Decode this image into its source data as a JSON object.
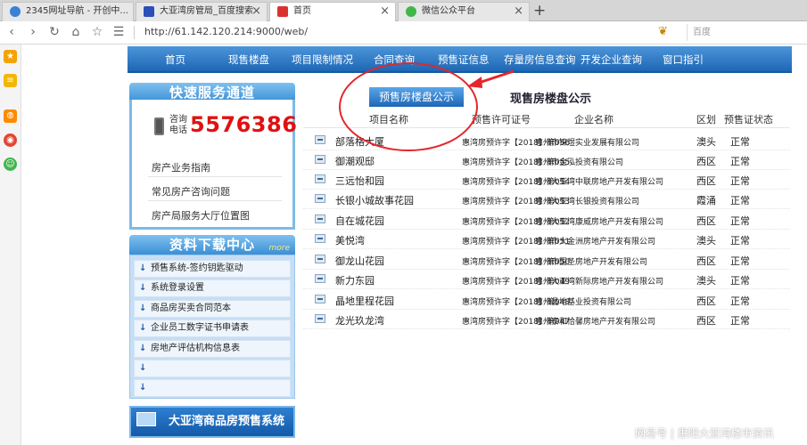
{
  "browser": {
    "tabs": [
      {
        "title": "2345网址导航 - 开创中...",
        "favicon_color": "#3b82d6",
        "active": false
      },
      {
        "title": "大亚湾房管局_百度搜索",
        "favicon_color": "#2b4fb8",
        "active": false
      },
      {
        "title": "首页",
        "favicon_color": "#d9322e",
        "active": true
      },
      {
        "title": "微信公众平台",
        "favicon_color": "#43b649",
        "active": false
      }
    ],
    "new_tab_label": "+",
    "tab_close_label": "×",
    "url": "http://61.142.120.214:9000/web/",
    "search_placeholder": "百度",
    "nav_icons": [
      "back-icon",
      "forward-icon",
      "reload-icon",
      "home-icon",
      "star-icon",
      "reader-icon"
    ]
  },
  "sidebar_icons": [
    {
      "name": "favorites-icon",
      "color": "#f4a300"
    },
    {
      "name": "notes-icon",
      "color": "#f2b705"
    },
    {
      "name": "rss-icon",
      "color": "#ff8a00"
    },
    {
      "name": "weibo-icon",
      "color": "#e24530"
    },
    {
      "name": "game-icon",
      "color": "#42b54f"
    }
  ],
  "site_nav": [
    "首页",
    "现售楼盘",
    "项目限制情况",
    "合同查询",
    "预售证信息",
    "存量房信息查询",
    "开发企业查询",
    "窗口指引"
  ],
  "service": {
    "title": "快速服务通道",
    "phone_label_1": "咨询",
    "phone_label_2": "电话",
    "phone_number": "5576386",
    "links": [
      "房产业务指南",
      "常见房产咨询问题",
      "房产局服务大厅位置图"
    ]
  },
  "downloads": {
    "title": "资料下载中心",
    "more": "more",
    "items": [
      "预售系统-签约钥匙驱动",
      "系统登录设置",
      "商品房买卖合同范本",
      "企业员工数字证书申请表",
      "房地产评估机构信息表",
      "",
      ""
    ]
  },
  "promo": "大亚湾商品房预售系统",
  "tabs": {
    "active": "预售房楼盘公示",
    "other": "现售房楼盘公示"
  },
  "table": {
    "headers": [
      "项目名称",
      "预售许可证号",
      "企业名称",
      "区划",
      "预售证状态"
    ],
    "rows": [
      {
        "name": "部落格大厦",
        "permit": "惠湾房预许字【2018】第056",
        "company": "惠州市锦煜实业发展有限公司",
        "district": "澳头",
        "status": "正常"
      },
      {
        "name": "御潮观邸",
        "permit": "惠湾房预许字【2018】第055",
        "company": "惠州市金泓投资有限公司",
        "district": "西区",
        "status": "正常"
      },
      {
        "name": "三远怡和园",
        "permit": "惠湾房预许字【2018】第054",
        "company": "惠州大亚湾中联房地产开发有限公司",
        "district": "西区",
        "status": "正常"
      },
      {
        "name": "长银小城故事花园",
        "permit": "惠湾房预许字【2018】第053",
        "company": "惠州大亚湾长银投资有限公司",
        "district": "霞涌",
        "status": "正常"
      },
      {
        "name": "自在城花园",
        "permit": "惠湾房预许字【2018】第052",
        "company": "惠州大亚湾康威房地产开发有限公司",
        "district": "西区",
        "status": "正常"
      },
      {
        "name": "美悦湾",
        "permit": "惠湾房预许字【2018】第051",
        "company": "惠州市大金洲房地产开发有限公司",
        "district": "澳头",
        "status": "正常"
      },
      {
        "name": "御龙山花园",
        "permit": "惠湾房预许字【2018】第050",
        "company": "惠州市国圣房地产开发有限公司",
        "district": "西区",
        "status": "正常"
      },
      {
        "name": "新力东园",
        "permit": "惠湾房预许字【2018】第049",
        "company": "惠州大亚湾新际房地产开发有限公司",
        "district": "澳头",
        "status": "正常"
      },
      {
        "name": "晶地里程花园",
        "permit": "惠湾房预许字【2018】第048",
        "company": "惠州晶地基业投资有限公司",
        "district": "西区",
        "status": "正常"
      },
      {
        "name": "龙光玖龙湾",
        "permit": "惠湾房预许字【2018】第047",
        "company": "惠州泰和恰馨房地产开发有限公司",
        "district": "西区",
        "status": "正常"
      }
    ]
  },
  "watermark": "网易号 | 惠阳大亚湾楼市资讯"
}
